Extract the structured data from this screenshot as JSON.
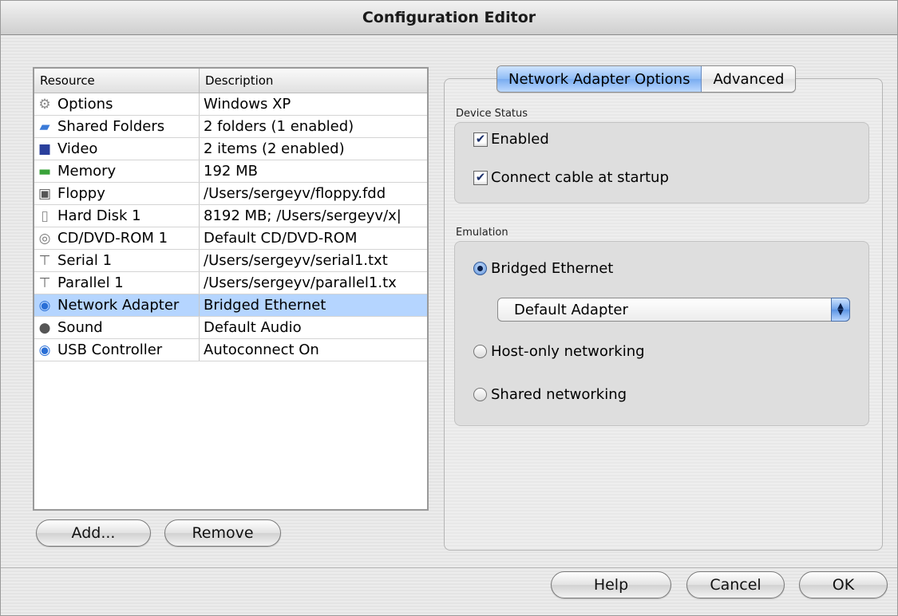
{
  "window": {
    "title": "Configuration Editor"
  },
  "table": {
    "headers": {
      "resource": "Resource",
      "description": "Description"
    },
    "rows": [
      {
        "icon": "options-icon",
        "resource": "Options",
        "description": "Windows XP",
        "selected": false
      },
      {
        "icon": "shared-folders-icon",
        "resource": "Shared Folders",
        "description": "2 folders (1 enabled)",
        "selected": false
      },
      {
        "icon": "video-icon",
        "resource": "Video",
        "description": "2 items (2 enabled)",
        "selected": false
      },
      {
        "icon": "memory-icon",
        "resource": "Memory",
        "description": "192 MB",
        "selected": false
      },
      {
        "icon": "floppy-icon",
        "resource": "Floppy",
        "description": "/Users/sergeyv/floppy.fdd",
        "selected": false
      },
      {
        "icon": "hard-disk-icon",
        "resource": "Hard Disk 1",
        "description": "8192 MB; /Users/sergeyv/x|",
        "selected": false
      },
      {
        "icon": "cd-dvd-icon",
        "resource": "CD/DVD-ROM 1",
        "description": "Default CD/DVD-ROM",
        "selected": false
      },
      {
        "icon": "serial-port-icon",
        "resource": "Serial 1",
        "description": "/Users/sergeyv/serial1.txt",
        "selected": false
      },
      {
        "icon": "parallel-port-icon",
        "resource": "Parallel 1",
        "description": "/Users/sergeyv/parallel1.tx",
        "selected": false
      },
      {
        "icon": "network-adapter-icon",
        "resource": "Network Adapter",
        "description": "Bridged Ethernet",
        "selected": true
      },
      {
        "icon": "sound-icon",
        "resource": "Sound",
        "description": "Default Audio",
        "selected": false
      },
      {
        "icon": "usb-controller-icon",
        "resource": "USB Controller",
        "description": "Autoconnect On",
        "selected": false
      }
    ]
  },
  "left_buttons": {
    "add": "Add...",
    "remove": "Remove"
  },
  "tabs": {
    "network": "Network Adapter Options",
    "advanced": "Advanced"
  },
  "device_status": {
    "label": "Device Status",
    "enabled": {
      "label": "Enabled",
      "checked": true
    },
    "connect_cable": {
      "label": "Connect cable at startup",
      "checked": true
    }
  },
  "emulation": {
    "label": "Emulation",
    "bridged": "Bridged Ethernet",
    "adapter_select": "Default Adapter",
    "host_only": "Host-only networking",
    "shared": "Shared networking",
    "selected": "bridged"
  },
  "footer": {
    "help": "Help",
    "cancel": "Cancel",
    "ok": "OK"
  },
  "colors": {
    "selection": "#b5d5ff",
    "aqua_blue": "#79acf0"
  }
}
